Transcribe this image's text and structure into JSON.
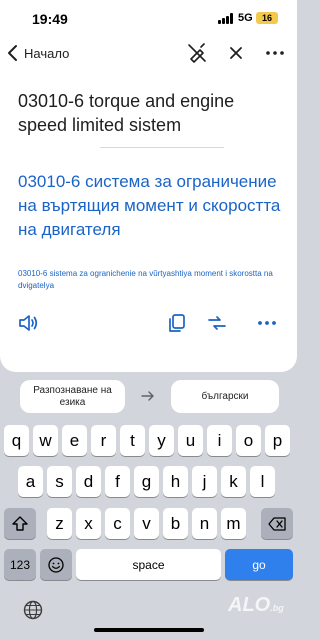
{
  "status_bar": {
    "time": "19:49",
    "network": "5G",
    "battery": "16",
    "battery_color": "#f2c94c"
  },
  "nav": {
    "back_label": "Начало",
    "icons": [
      "chevron-left-icon",
      "no-edit-icon",
      "close-icon",
      "more-icon"
    ]
  },
  "source_text": "03010-6 torque and engine speed limited sistem",
  "translation_text": "03010-6 система за ограничение на въртящия момент и скоростта на двигателя",
  "transliteration_text": "03010-6 sistema za ogranichenie na vŭrtyashtiya moment i skorostta na dvigatelya",
  "actions": {
    "icons": [
      "speaker-icon",
      "copy-icon",
      "swap-icon",
      "more-icon"
    ]
  },
  "language_bar": {
    "source_label": "Разпознаване на езика",
    "target_label": "български"
  },
  "keyboard": {
    "row1": [
      "q",
      "w",
      "e",
      "r",
      "t",
      "y",
      "u",
      "i",
      "o",
      "p"
    ],
    "row2": [
      "a",
      "s",
      "d",
      "f",
      "g",
      "h",
      "j",
      "k",
      "l"
    ],
    "row3": [
      "z",
      "x",
      "c",
      "v",
      "b",
      "n",
      "m"
    ],
    "numbers_label": "123",
    "space_label": "space",
    "go_label": "go"
  },
  "watermark": {
    "main": "ALO",
    "suffix": ".bg"
  },
  "colors": {
    "accent": "#1a64c8",
    "go_key": "#2f80ed"
  }
}
